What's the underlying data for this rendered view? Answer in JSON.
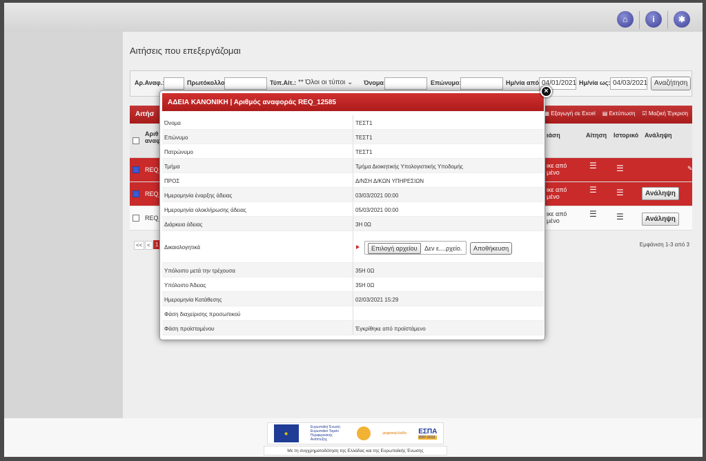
{
  "page": {
    "title": "Αιτήσεις που επεξεργάζομαι"
  },
  "topbar": {
    "icons": [
      "home-icon",
      "info-icon",
      "settings-icon"
    ]
  },
  "filters": {
    "ref_label": "Αρ.Αναφ.:",
    "protocol_label": "Πρωτόκολλο:",
    "type_label": "Τύπ.Αίτ.:",
    "type_value": "** Όλοι οι τύποι",
    "name_label": "Όνομα:",
    "surname_label": "Επώνυμο:",
    "from_label": "Ημ/νία από:",
    "from_value": "04/01/2021",
    "to_label": "Ημ/νία ως:",
    "to_value": "04/03/2021",
    "search_button": "Αναζήτηση"
  },
  "grid": {
    "title": "Αιτήσ",
    "tools": {
      "excel": "Εξαγωγή σε Excel",
      "print": "Εκτύπωση",
      "bulk": "Μαζική Έγκριση"
    },
    "headers": {
      "ref": "Αριθ αναφ",
      "phase": "ιάση",
      "request": "Αίτηση",
      "history": "Ιστορικό",
      "take": "Ανάληψη"
    },
    "rows": [
      {
        "ref": "REQ_",
        "phase": "ικε από\nμένο",
        "take": ""
      },
      {
        "ref": "REQ_",
        "phase": "ικε από\nμένο",
        "take": "Ανάληψη"
      },
      {
        "ref": "REQ_",
        "phase": "ικε από\nμένο",
        "take": "Ανάληψη"
      }
    ],
    "pager": {
      "prev1": "<<",
      "prev2": "<",
      "page": "1",
      "summary": "Εμφάνιση 1-3 από 3"
    }
  },
  "modal": {
    "title": "ΑΔΕΙΑ ΚΑΝΟΝΙΚΗ | Αριθμός αναφοράς REQ_12585",
    "rows": [
      {
        "label": "Όνομα",
        "value": "ΤΕΣΤ1"
      },
      {
        "label": "Επώνυμο",
        "value": "ΤΕΣΤ1"
      },
      {
        "label": "Πατρώνυμο",
        "value": "ΤΕΣΤ1"
      },
      {
        "label": "Τμήμα",
        "value": "Τμήμα Διοικητικής Υπολογιστικής Υποδομής"
      },
      {
        "label": "ΠΡΟΣ",
        "value": "Δ/ΝΣΗ Δ/ΚΩΝ ΥΠΗΡΕΣΙΩΝ"
      },
      {
        "label": "Ημερομηνία έναρξης άδειας",
        "value": "03/03/2021 00:00"
      },
      {
        "label": "Ημερομηνία ολοκλήρωσης άδειας",
        "value": "05/03/2021 00:00"
      },
      {
        "label": "Διάρκεια άδειας",
        "value": "3Η 0Ω"
      }
    ],
    "attachments": {
      "label": "Δικαιολογητικά",
      "choose_button": "Επιλογή αρχείου",
      "no_file": "Δεν ε....ρχείο.",
      "save_button": "Αποθήκευση"
    },
    "rows2": [
      {
        "label": "Υπόλοιπο μετά την τρέχουσα",
        "value": "35Η 0Ω"
      },
      {
        "label": "Υπόλοιπο Άδειας",
        "value": "35Η 0Ω"
      },
      {
        "label": "Ημερομηνία Κατάθεσης",
        "value": "02/03/2021 15:29"
      },
      {
        "label": "Φάση διαχείρισης προσωπικού",
        "value": ""
      },
      {
        "label": "Φάση προϊσταμένου",
        "value": "Έγκρίθηκε από προϊστάμενο"
      }
    ]
  },
  "footer": {
    "eu_text": "Ευρωπαϊκή Ένωση",
    "eu_sub": "Ευρωπαϊκό Ταμείο Περιφερειακής Ανάπτυξης",
    "digital_text": "ψηφιακήελλάδα",
    "espa_text": "ΕΣΠΑ",
    "espa_years": "2007-2013",
    "caption": "Με τη συγχρηματοδότηση της Ελλάδας και της Ευρωπαϊκής Ένωσης"
  }
}
